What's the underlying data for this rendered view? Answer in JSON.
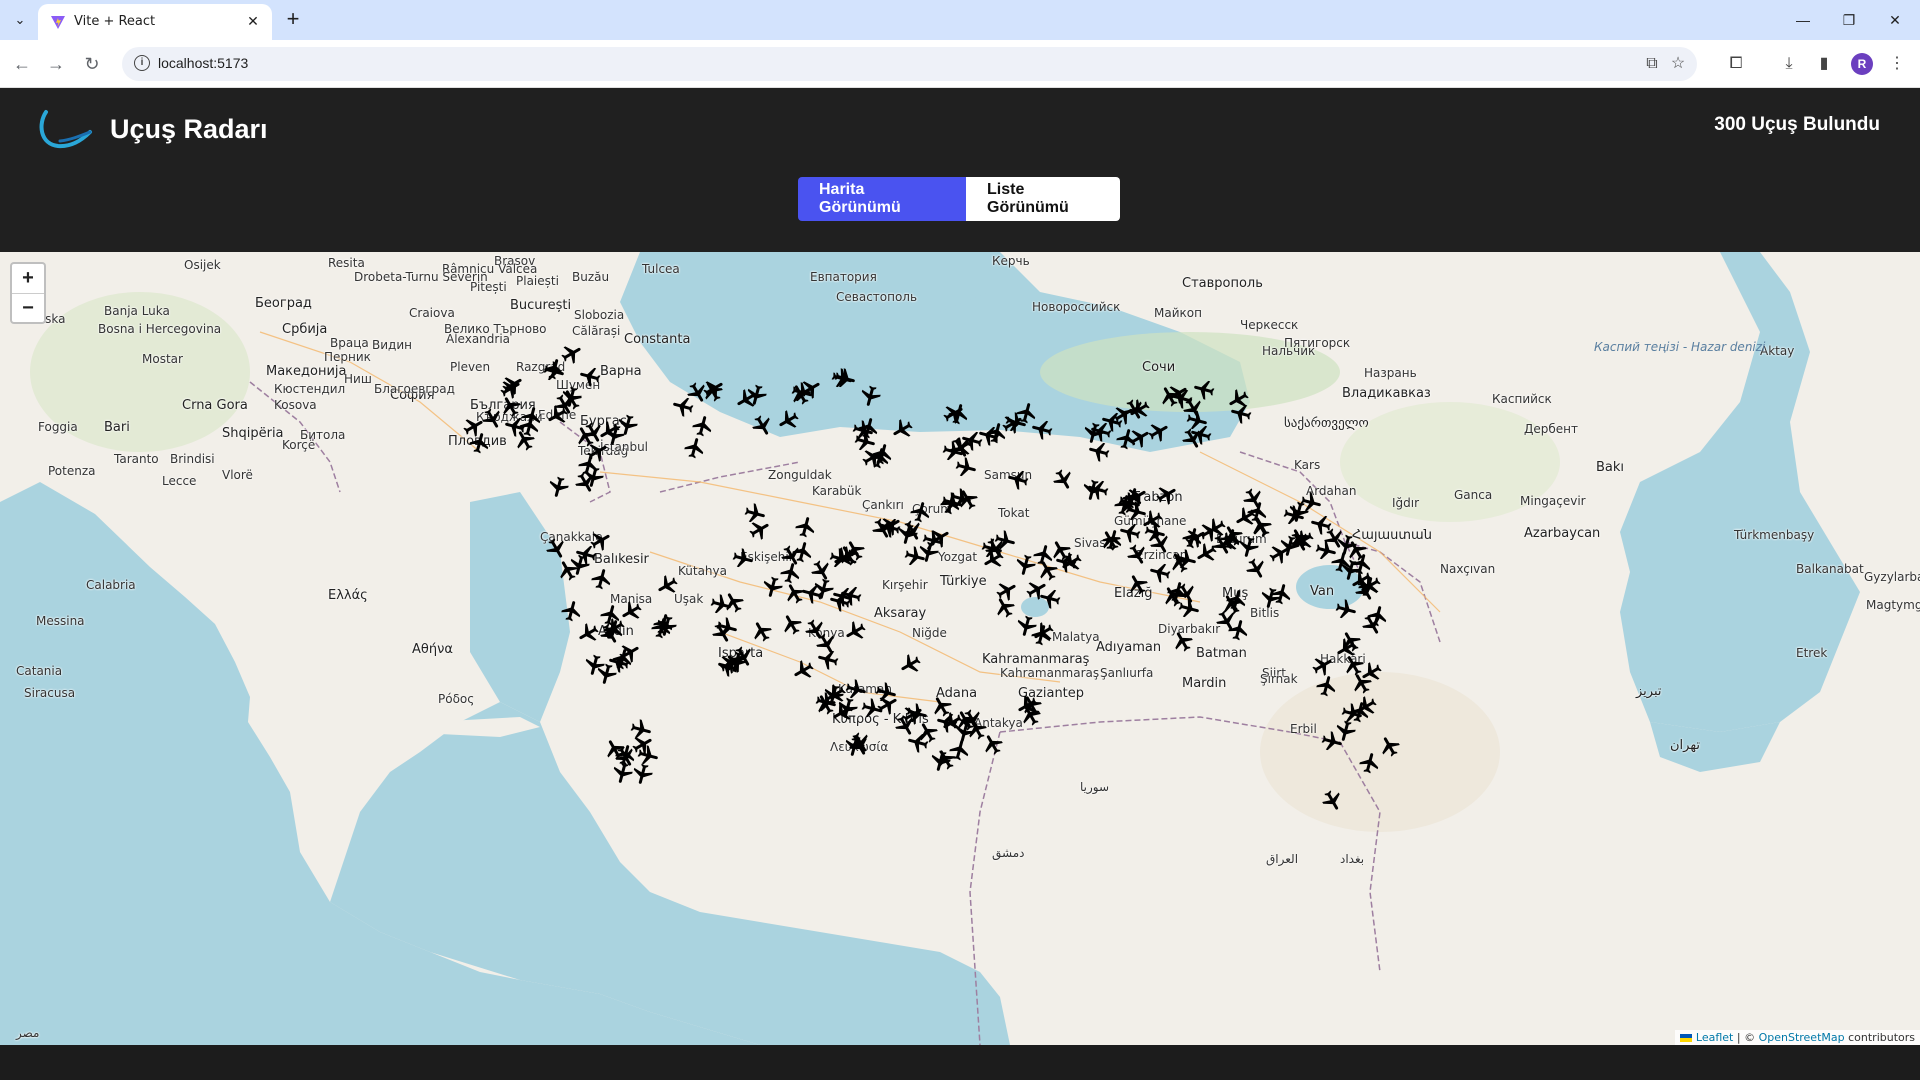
{
  "browser": {
    "tab_title": "Vite + React",
    "url": "localhost:5173",
    "profile_initial": "R"
  },
  "app": {
    "title": "Uçuş Radarı",
    "flight_count": "300 Uçuş Bulundu",
    "views": {
      "map": "Harita Görünümü",
      "list": "Liste Görünümü"
    }
  },
  "map": {
    "zoom_in": "+",
    "zoom_out": "−",
    "attribution": {
      "leaflet": "Leaflet",
      "sep": " | © ",
      "osm": "OpenStreetMap",
      "suffix": " contributors"
    },
    "labels": [
      {
        "text": "Brașov"
      },
      {
        "text": "Tulcea"
      },
      {
        "text": "Керчь"
      },
      {
        "text": "Ставрополь"
      },
      {
        "text": "Евпатория"
      },
      {
        "text": "Севастополь"
      },
      {
        "text": "Новороссийск"
      },
      {
        "text": "Майкоп"
      },
      {
        "text": "Черкесск"
      },
      {
        "text": "Пятигорск"
      },
      {
        "text": "Aktay"
      },
      {
        "text": "Београд"
      },
      {
        "text": "Craiova"
      },
      {
        "text": "București"
      },
      {
        "text": "Constanta"
      },
      {
        "text": "Bosna i Hercegovina"
      },
      {
        "text": "Србија"
      },
      {
        "text": "Видин"
      },
      {
        "text": "Alexandria"
      },
      {
        "text": "Варна"
      },
      {
        "text": "Сочи"
      },
      {
        "text": "Нальчик"
      },
      {
        "text": "Назрань"
      },
      {
        "text": "Владикавказ"
      },
      {
        "text": "Каспийск"
      },
      {
        "text": "София"
      },
      {
        "text": "България"
      },
      {
        "text": "Бургас"
      },
      {
        "text": "Kosova"
      },
      {
        "text": "Пловдив"
      },
      {
        "text": "საქართველო"
      },
      {
        "text": "Дербент"
      },
      {
        "text": "Каспий теңізі - Hazar denizi"
      },
      {
        "text": "Zonguldak"
      },
      {
        "text": "Karabük"
      },
      {
        "text": "Samsun"
      },
      {
        "text": "Trabzon"
      },
      {
        "text": "Ardahan"
      },
      {
        "text": "Gümüşhane"
      },
      {
        "text": "Erzurum"
      },
      {
        "text": "Bakı"
      },
      {
        "text": "Ganca"
      },
      {
        "text": "Mingaçevir"
      },
      {
        "text": "Azarbaycan"
      },
      {
        "text": "Türkmenbaşy"
      },
      {
        "text": "Shqipëria"
      },
      {
        "text": "Македонија"
      },
      {
        "text": "Bari"
      },
      {
        "text": "Taranto"
      },
      {
        "text": "Brindisi"
      },
      {
        "text": "Edirne"
      },
      {
        "text": "Tekirdağ"
      },
      {
        "text": "Çankırı"
      },
      {
        "text": "Çorum"
      },
      {
        "text": "Tokat"
      },
      {
        "text": "Sivas"
      },
      {
        "text": "Erzincan"
      },
      {
        "text": "Kars"
      },
      {
        "text": "Հայաստան"
      },
      {
        "text": "Naxçıvan"
      },
      {
        "text": "Balıkesir"
      },
      {
        "text": "Eskişehir"
      },
      {
        "text": "Kırşehir"
      },
      {
        "text": "Yozgat"
      },
      {
        "text": "Türkiye"
      },
      {
        "text": "Elazığ"
      },
      {
        "text": "Muş"
      },
      {
        "text": "Bitlis"
      },
      {
        "text": "Van"
      },
      {
        "text": "Ελλάς"
      },
      {
        "text": "Uşak"
      },
      {
        "text": "Aksaray"
      },
      {
        "text": "Niğde"
      },
      {
        "text": "Malatya"
      },
      {
        "text": "Diyarbakır"
      },
      {
        "text": "Batman"
      },
      {
        "text": "Siirt"
      },
      {
        "text": "Hakkâri"
      },
      {
        "text": "Αθήνα"
      },
      {
        "text": "Aydın"
      },
      {
        "text": "Isparta"
      },
      {
        "text": "Konya"
      },
      {
        "text": "Kahramanmaraş"
      },
      {
        "text": "Adıyaman"
      },
      {
        "text": "Mardin"
      },
      {
        "text": "Şırnak"
      },
      {
        "text": "Karaman"
      },
      {
        "text": "Adana"
      },
      {
        "text": "Gaziantep"
      },
      {
        "text": "Antakya"
      },
      {
        "text": "Κύπρος - Kıbrıs"
      },
      {
        "text": "Λευκωσία"
      },
      {
        "text": "Erbil"
      },
      {
        "text": "تبریز"
      },
      {
        "text": "سوريا"
      },
      {
        "text": "العراق"
      },
      {
        "text": "تهران"
      },
      {
        "text": "بغداد"
      },
      {
        "text": "دمشق"
      },
      {
        "text": "Messina"
      },
      {
        "text": "Catania"
      },
      {
        "text": "Siracusa"
      },
      {
        "text": "Mostar"
      },
      {
        "text": "Banja Luka"
      },
      {
        "text": "Hrvatska"
      },
      {
        "text": "Osijek"
      },
      {
        "text": "Pleven"
      },
      {
        "text": "Razgrad"
      },
      {
        "text": "Шумен"
      },
      {
        "text": "Potenza"
      },
      {
        "text": "Foggia"
      },
      {
        "text": "Crna Gora"
      },
      {
        "text": "Ниш"
      },
      {
        "text": "Plaiești"
      },
      {
        "text": "Slobozia"
      },
      {
        "text": "Buzău"
      },
      {
        "text": "Călărași"
      },
      {
        "text": "Râmnicu Vâlcea"
      },
      {
        "text": "Pitești"
      },
      {
        "text": "Drobeta-Turnu Severin"
      },
      {
        "text": "Resita"
      },
      {
        "text": "Lecce"
      },
      {
        "text": "Vlorë"
      },
      {
        "text": "Korçë"
      },
      {
        "text": "Битола"
      },
      {
        "text": "Кърджали"
      },
      {
        "text": "Благоевград"
      },
      {
        "text": "Кюстендил"
      },
      {
        "text": "Перник"
      },
      {
        "text": "Враца"
      },
      {
        "text": "Велико Търново"
      },
      {
        "text": "Etrek"
      },
      {
        "text": "Gyzylarbat"
      },
      {
        "text": "Magtymguly"
      },
      {
        "text": "Balkanabat"
      },
      {
        "text": "Calabria"
      },
      {
        "text": "Kütahya"
      },
      {
        "text": "Manisa"
      },
      {
        "text": "Çanakkale"
      },
      {
        "text": "Şanlıurfa"
      },
      {
        "text": "Iğdır"
      },
      {
        "text": "مصر"
      },
      {
        "text": "Kahramanmaraş"
      },
      {
        "text": "Ρόδος"
      },
      {
        "text": "İstanbul"
      }
    ],
    "flights_total": 300
  },
  "colors": {
    "header_bg": "#202020",
    "accent": "#4a53f0",
    "sea": "#aad3df",
    "land": "#f2efe9",
    "plane": "#000000"
  },
  "icons": [
    "vite-favicon",
    "close-icon",
    "plus-icon",
    "chevron-down-icon",
    "back-icon",
    "forward-icon",
    "reload-icon",
    "info-icon",
    "translate-icon",
    "star-icon",
    "extensions-icon",
    "download-icon",
    "sidebar-icon",
    "menu-icon",
    "logo-icon",
    "airplane-icon"
  ]
}
